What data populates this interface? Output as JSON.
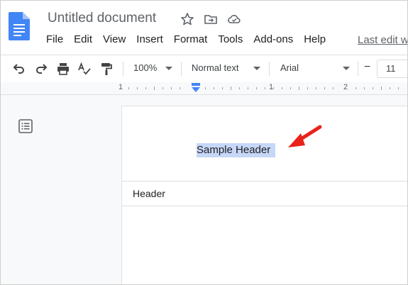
{
  "document": {
    "title": "Untitled document"
  },
  "menu": {
    "items": [
      "File",
      "Edit",
      "View",
      "Insert",
      "Format",
      "Tools",
      "Add-ons",
      "Help"
    ],
    "last_edit": "Last edit w"
  },
  "toolbar": {
    "zoom": "100%",
    "style": "Normal text",
    "font": "Arial",
    "font_size_decrease": "−",
    "font_size": "11"
  },
  "ruler": {
    "marks": [
      "1",
      "1",
      "2"
    ]
  },
  "page": {
    "selected_text": "Sample Header",
    "header_label": "Header"
  },
  "colors": {
    "selection": "#c6d7f7",
    "arrow": "#e8221b",
    "docs_blue": "#4285f4"
  }
}
